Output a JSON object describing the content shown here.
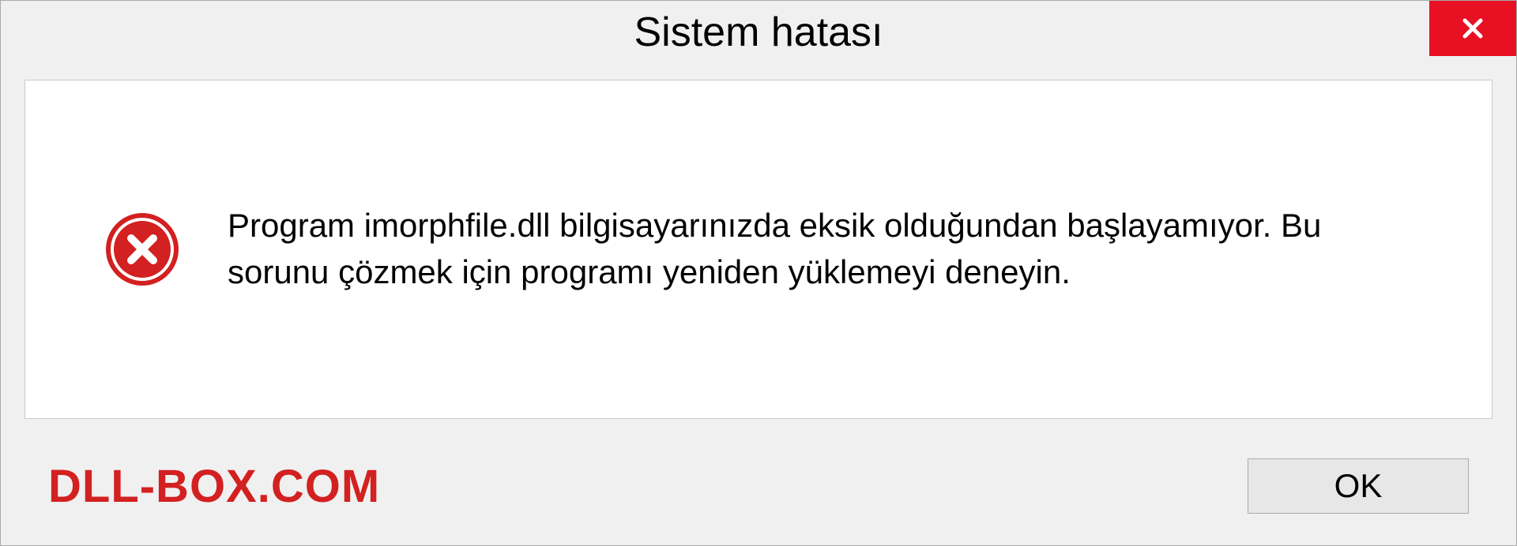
{
  "dialog": {
    "title": "Sistem hatası",
    "message": "Program imorphfile.dll bilgisayarınızda eksik olduğundan başlayamıyor. Bu sorunu çözmek için programı yeniden yüklemeyi deneyin.",
    "ok_label": "OK"
  },
  "watermark": "DLL-BOX.COM"
}
